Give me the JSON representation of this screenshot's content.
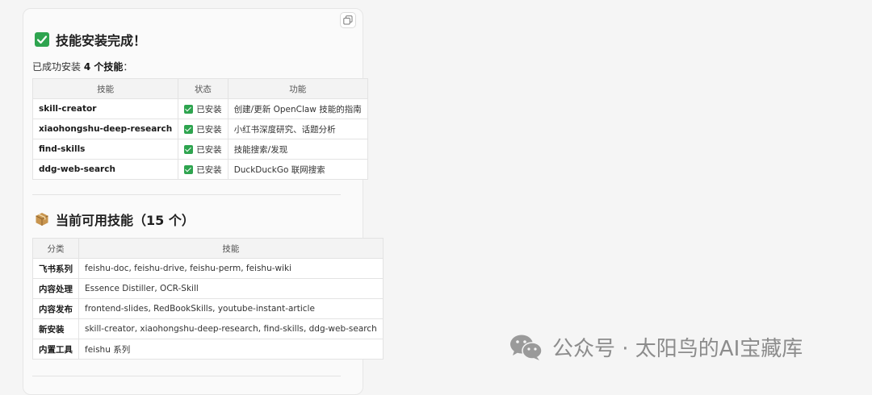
{
  "installed_section": {
    "heading": "技能安装完成！",
    "intro_prefix": "已成功安装 ",
    "intro_bold": "4 个技能",
    "intro_suffix": "：",
    "columns": [
      "技能",
      "状态",
      "功能"
    ],
    "rows": [
      {
        "name": "skill-creator",
        "status": "已安装",
        "function": "创建/更新 OpenClaw 技能的指南"
      },
      {
        "name": "xiaohongshu-deep-research",
        "status": "已安装",
        "function": "小红书深度研究、话题分析"
      },
      {
        "name": "find-skills",
        "status": "已安装",
        "function": "技能搜索/发现"
      },
      {
        "name": "ddg-web-search",
        "status": "已安装",
        "function": "DuckDuckGo 联网搜索"
      }
    ]
  },
  "available_section": {
    "heading": "当前可用技能（15 个）",
    "columns": [
      "分类",
      "技能"
    ],
    "rows": [
      {
        "category": "飞书系列",
        "skills": "feishu-doc, feishu-drive, feishu-perm, feishu-wiki"
      },
      {
        "category": "内容处理",
        "skills": "Essence Distiller, OCR-Skill"
      },
      {
        "category": "内容发布",
        "skills": "frontend-slides, RedBookSkills, youtube-instant-article"
      },
      {
        "category": "新安装",
        "skills": "skill-creator, xiaohongshu-deep-research, find-skills, ddg-web-search"
      },
      {
        "category": "内置工具",
        "skills": "feishu 系列"
      }
    ]
  },
  "watermark": {
    "text": "公众号 · 太阳鸟的AI宝藏库"
  },
  "icons": {
    "heading1": "check-mark-box-icon",
    "heading2": "package-icon",
    "copy": "copy-icon",
    "watermark": "wechat-icon"
  },
  "colors": {
    "check_green": "#2ea44f",
    "package_brown": "#c8954f"
  }
}
